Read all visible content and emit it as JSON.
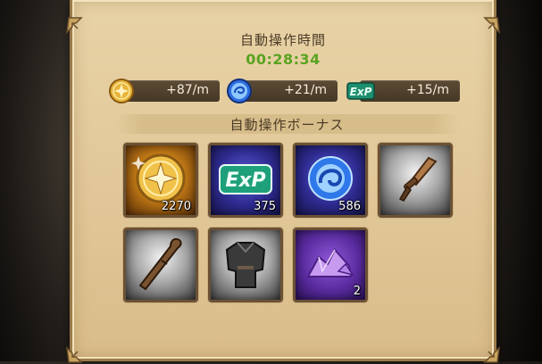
{
  "header": {
    "title": "自動操作時間",
    "timer": "00:28:34"
  },
  "rates": [
    {
      "icon": "gold-coin-icon",
      "value": "+87/m"
    },
    {
      "icon": "blue-orb-icon",
      "value": "+21/m"
    },
    {
      "icon": "exp-icon",
      "value": "+15/m"
    }
  ],
  "bonus": {
    "title": "自動操作ボーナス",
    "items": [
      {
        "name": "gold-coin",
        "qty": "2270"
      },
      {
        "name": "exp-token",
        "qty": "375"
      },
      {
        "name": "blue-orb",
        "qty": "586"
      },
      {
        "name": "wooden-dagger",
        "qty": ""
      },
      {
        "name": "wooden-staff",
        "qty": ""
      },
      {
        "name": "leather-armor",
        "qty": ""
      },
      {
        "name": "purple-ore",
        "qty": "2"
      }
    ]
  },
  "colors": {
    "timer": "#5aa321",
    "panel": "#e2c899",
    "rate_bar": "#4f4030"
  }
}
